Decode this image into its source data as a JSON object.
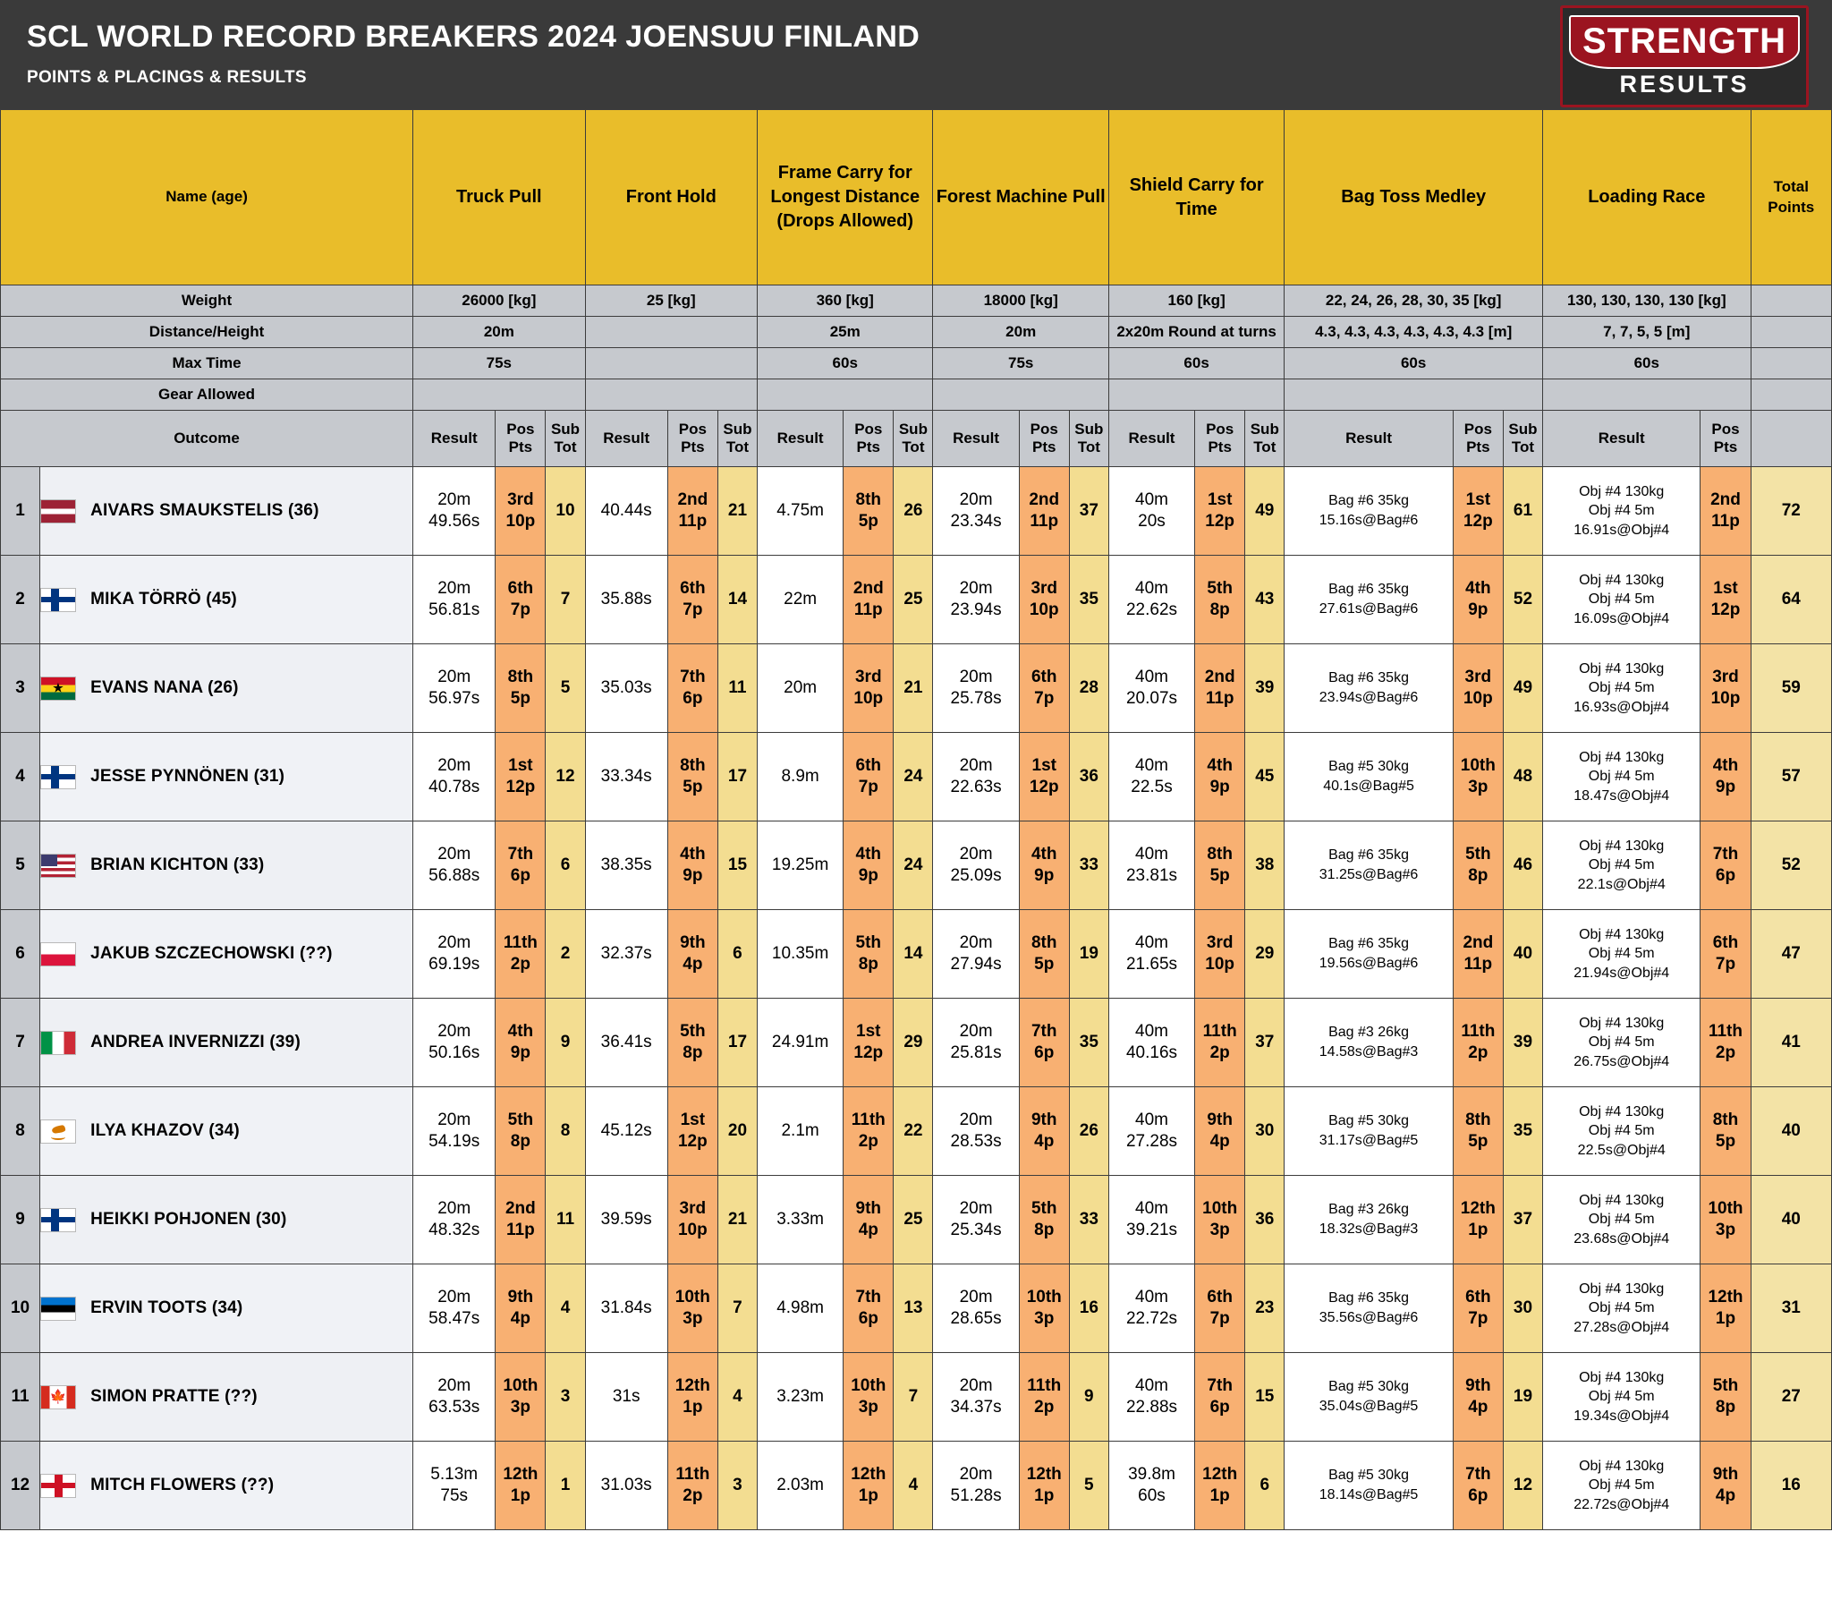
{
  "header": {
    "title": "SCL WORLD RECORD BREAKERS 2024 JOENSUU FINLAND",
    "subtitle": "POINTS & PLACINGS & RESULTS",
    "logo_top": "STRENGTH",
    "logo_bottom": "RESULTS",
    "accent_yellow": "#e9bd2a",
    "accent_dark": "#3a3a3a",
    "accent_red": "#9b1420",
    "name_blue": "#1878e8"
  },
  "columns": {
    "name": "Name (age)",
    "events": [
      "Truck Pull",
      "Front Hold",
      "Frame Carry for Longest Distance (Drops Allowed)",
      "Forest Machine Pull",
      "Shield Carry for Time",
      "Bag Toss Medley",
      "Loading Race"
    ],
    "total": "Total Points",
    "sub_headers": {
      "result": "Result",
      "pos_pts": "Pos Pts",
      "sub_tot": "Sub Tot"
    }
  },
  "meta_rows": {
    "labels": [
      "Weight",
      "Distance/Height",
      "Max Time",
      "Gear Allowed",
      "Outcome"
    ],
    "weight": [
      "26000 [kg]",
      "25 [kg]",
      "360 [kg]",
      "18000 [kg]",
      "160 [kg]",
      "22, 24, 26, 28, 30, 35 [kg]",
      "130, 130, 130, 130 [kg]"
    ],
    "distance": [
      "20m",
      "",
      "25m",
      "20m",
      "2x20m Round at turns",
      "4.3, 4.3, 4.3, 4.3, 4.3, 4.3 [m]",
      "7, 7, 5, 5 [m]"
    ],
    "maxtime": [
      "75s",
      "",
      "60s",
      "75s",
      "60s",
      "60s",
      "60s"
    ],
    "gear": [
      "",
      "",
      "",
      "",
      "",
      "",
      ""
    ]
  },
  "rows": [
    {
      "rank": "1",
      "flag": "lv",
      "name": "AIVARS SMAUKSTELIS (36)",
      "total": "72",
      "e": [
        {
          "r": "20m\n49.56s",
          "p": "3rd\n10p",
          "s": "10"
        },
        {
          "r": "40.44s",
          "p": "2nd\n11p",
          "s": "21"
        },
        {
          "r": "4.75m",
          "p": "8th\n5p",
          "s": "26"
        },
        {
          "r": "20m\n23.34s",
          "p": "2nd\n11p",
          "s": "37"
        },
        {
          "r": "40m\n20s",
          "p": "1st\n12p",
          "s": "49"
        },
        {
          "r": "Bag #6 35kg\n15.16s@Bag#6",
          "p": "1st\n12p",
          "s": "61"
        },
        {
          "r": "Obj #4 130kg\nObj #4 5m\n16.91s@Obj#4",
          "p": "2nd\n11p",
          "s": null
        }
      ]
    },
    {
      "rank": "2",
      "flag": "fi",
      "name": "MIKA TÖRRÖ (45)",
      "total": "64",
      "e": [
        {
          "r": "20m\n56.81s",
          "p": "6th\n7p",
          "s": "7"
        },
        {
          "r": "35.88s",
          "p": "6th\n7p",
          "s": "14"
        },
        {
          "r": "22m",
          "p": "2nd\n11p",
          "s": "25"
        },
        {
          "r": "20m\n23.94s",
          "p": "3rd\n10p",
          "s": "35"
        },
        {
          "r": "40m\n22.62s",
          "p": "5th\n8p",
          "s": "43"
        },
        {
          "r": "Bag #6 35kg\n27.61s@Bag#6",
          "p": "4th\n9p",
          "s": "52"
        },
        {
          "r": "Obj #4 130kg\nObj #4 5m\n16.09s@Obj#4",
          "p": "1st\n12p",
          "s": null
        }
      ]
    },
    {
      "rank": "3",
      "flag": "gh",
      "name": "EVANS NANA (26)",
      "total": "59",
      "e": [
        {
          "r": "20m\n56.97s",
          "p": "8th\n5p",
          "s": "5"
        },
        {
          "r": "35.03s",
          "p": "7th\n6p",
          "s": "11"
        },
        {
          "r": "20m",
          "p": "3rd\n10p",
          "s": "21"
        },
        {
          "r": "20m\n25.78s",
          "p": "6th\n7p",
          "s": "28"
        },
        {
          "r": "40m\n20.07s",
          "p": "2nd\n11p",
          "s": "39"
        },
        {
          "r": "Bag #6 35kg\n23.94s@Bag#6",
          "p": "3rd\n10p",
          "s": "49"
        },
        {
          "r": "Obj #4 130kg\nObj #4 5m\n16.93s@Obj#4",
          "p": "3rd\n10p",
          "s": null
        }
      ]
    },
    {
      "rank": "4",
      "flag": "fi",
      "name": "JESSE PYNNÖNEN (31)",
      "total": "57",
      "e": [
        {
          "r": "20m\n40.78s",
          "p": "1st\n12p",
          "s": "12"
        },
        {
          "r": "33.34s",
          "p": "8th\n5p",
          "s": "17"
        },
        {
          "r": "8.9m",
          "p": "6th\n7p",
          "s": "24"
        },
        {
          "r": "20m\n22.63s",
          "p": "1st\n12p",
          "s": "36"
        },
        {
          "r": "40m\n22.5s",
          "p": "4th\n9p",
          "s": "45"
        },
        {
          "r": "Bag #5 30kg\n40.1s@Bag#5",
          "p": "10th\n3p",
          "s": "48"
        },
        {
          "r": "Obj #4 130kg\nObj #4 5m\n18.47s@Obj#4",
          "p": "4th\n9p",
          "s": null
        }
      ]
    },
    {
      "rank": "5",
      "flag": "us",
      "name": "BRIAN KICHTON (33)",
      "total": "52",
      "e": [
        {
          "r": "20m\n56.88s",
          "p": "7th\n6p",
          "s": "6"
        },
        {
          "r": "38.35s",
          "p": "4th\n9p",
          "s": "15"
        },
        {
          "r": "19.25m",
          "p": "4th\n9p",
          "s": "24"
        },
        {
          "r": "20m\n25.09s",
          "p": "4th\n9p",
          "s": "33"
        },
        {
          "r": "40m\n23.81s",
          "p": "8th\n5p",
          "s": "38"
        },
        {
          "r": "Bag #6 35kg\n31.25s@Bag#6",
          "p": "5th\n8p",
          "s": "46"
        },
        {
          "r": "Obj #4 130kg\nObj #4 5m\n22.1s@Obj#4",
          "p": "7th\n6p",
          "s": null
        }
      ]
    },
    {
      "rank": "6",
      "flag": "pl",
      "name": "JAKUB SZCZECHOWSKI (??)",
      "total": "47",
      "e": [
        {
          "r": "20m\n69.19s",
          "p": "11th\n2p",
          "s": "2"
        },
        {
          "r": "32.37s",
          "p": "9th\n4p",
          "s": "6"
        },
        {
          "r": "10.35m",
          "p": "5th\n8p",
          "s": "14"
        },
        {
          "r": "20m\n27.94s",
          "p": "8th\n5p",
          "s": "19"
        },
        {
          "r": "40m\n21.65s",
          "p": "3rd\n10p",
          "s": "29"
        },
        {
          "r": "Bag #6 35kg\n19.56s@Bag#6",
          "p": "2nd\n11p",
          "s": "40"
        },
        {
          "r": "Obj #4 130kg\nObj #4 5m\n21.94s@Obj#4",
          "p": "6th\n7p",
          "s": null
        }
      ]
    },
    {
      "rank": "7",
      "flag": "it",
      "name": "ANDREA INVERNIZZI (39)",
      "total": "41",
      "e": [
        {
          "r": "20m\n50.16s",
          "p": "4th\n9p",
          "s": "9"
        },
        {
          "r": "36.41s",
          "p": "5th\n8p",
          "s": "17"
        },
        {
          "r": "24.91m",
          "p": "1st\n12p",
          "s": "29"
        },
        {
          "r": "20m\n25.81s",
          "p": "7th\n6p",
          "s": "35"
        },
        {
          "r": "40m\n40.16s",
          "p": "11th\n2p",
          "s": "37"
        },
        {
          "r": "Bag #3 26kg\n14.58s@Bag#3",
          "p": "11th\n2p",
          "s": "39"
        },
        {
          "r": "Obj #4 130kg\nObj #4 5m\n26.75s@Obj#4",
          "p": "11th\n2p",
          "s": null
        }
      ]
    },
    {
      "rank": "8",
      "flag": "cy",
      "name": "ILYA KHAZOV (34)",
      "total": "40",
      "e": [
        {
          "r": "20m\n54.19s",
          "p": "5th\n8p",
          "s": "8"
        },
        {
          "r": "45.12s",
          "p": "1st\n12p",
          "s": "20"
        },
        {
          "r": "2.1m",
          "p": "11th\n2p",
          "s": "22"
        },
        {
          "r": "20m\n28.53s",
          "p": "9th\n4p",
          "s": "26"
        },
        {
          "r": "40m\n27.28s",
          "p": "9th\n4p",
          "s": "30"
        },
        {
          "r": "Bag #5 30kg\n31.17s@Bag#5",
          "p": "8th\n5p",
          "s": "35"
        },
        {
          "r": "Obj #4 130kg\nObj #4 5m\n22.5s@Obj#4",
          "p": "8th\n5p",
          "s": null
        }
      ]
    },
    {
      "rank": "9",
      "flag": "fi",
      "name": "HEIKKI POHJONEN (30)",
      "total": "40",
      "e": [
        {
          "r": "20m\n48.32s",
          "p": "2nd\n11p",
          "s": "11"
        },
        {
          "r": "39.59s",
          "p": "3rd\n10p",
          "s": "21"
        },
        {
          "r": "3.33m",
          "p": "9th\n4p",
          "s": "25"
        },
        {
          "r": "20m\n25.34s",
          "p": "5th\n8p",
          "s": "33"
        },
        {
          "r": "40m\n39.21s",
          "p": "10th\n3p",
          "s": "36"
        },
        {
          "r": "Bag #3 26kg\n18.32s@Bag#3",
          "p": "12th\n1p",
          "s": "37"
        },
        {
          "r": "Obj #4 130kg\nObj #4 5m\n23.68s@Obj#4",
          "p": "10th\n3p",
          "s": null
        }
      ]
    },
    {
      "rank": "10",
      "flag": "ee",
      "name": "ERVIN TOOTS (34)",
      "total": "31",
      "e": [
        {
          "r": "20m\n58.47s",
          "p": "9th\n4p",
          "s": "4"
        },
        {
          "r": "31.84s",
          "p": "10th\n3p",
          "s": "7"
        },
        {
          "r": "4.98m",
          "p": "7th\n6p",
          "s": "13"
        },
        {
          "r": "20m\n28.65s",
          "p": "10th\n3p",
          "s": "16"
        },
        {
          "r": "40m\n22.72s",
          "p": "6th\n7p",
          "s": "23"
        },
        {
          "r": "Bag #6 35kg\n35.56s@Bag#6",
          "p": "6th\n7p",
          "s": "30"
        },
        {
          "r": "Obj #4 130kg\nObj #4 5m\n27.28s@Obj#4",
          "p": "12th\n1p",
          "s": null
        }
      ]
    },
    {
      "rank": "11",
      "flag": "ca",
      "name": "SIMON PRATTE (??)",
      "total": "27",
      "e": [
        {
          "r": "20m\n63.53s",
          "p": "10th\n3p",
          "s": "3"
        },
        {
          "r": "31s",
          "p": "12th\n1p",
          "s": "4"
        },
        {
          "r": "3.23m",
          "p": "10th\n3p",
          "s": "7"
        },
        {
          "r": "20m\n34.37s",
          "p": "11th\n2p",
          "s": "9"
        },
        {
          "r": "40m\n22.88s",
          "p": "7th\n6p",
          "s": "15"
        },
        {
          "r": "Bag #5 30kg\n35.04s@Bag#5",
          "p": "9th\n4p",
          "s": "19"
        },
        {
          "r": "Obj #4 130kg\nObj #4 5m\n19.34s@Obj#4",
          "p": "5th\n8p",
          "s": null
        }
      ]
    },
    {
      "rank": "12",
      "flag": "en",
      "name": "MITCH FLOWERS (??)",
      "total": "16",
      "e": [
        {
          "r": "5.13m\n75s",
          "p": "12th\n1p",
          "s": "1"
        },
        {
          "r": "31.03s",
          "p": "11th\n2p",
          "s": "3"
        },
        {
          "r": "2.03m",
          "p": "12th\n1p",
          "s": "4"
        },
        {
          "r": "20m\n51.28s",
          "p": "12th\n1p",
          "s": "5"
        },
        {
          "r": "39.8m\n60s",
          "p": "12th\n1p",
          "s": "6"
        },
        {
          "r": "Bag #5 30kg\n18.14s@Bag#5",
          "p": "7th\n6p",
          "s": "12"
        },
        {
          "r": "Obj #4 130kg\nObj #4 5m\n22.72s@Obj#4",
          "p": "9th\n4p",
          "s": null
        }
      ]
    }
  ]
}
